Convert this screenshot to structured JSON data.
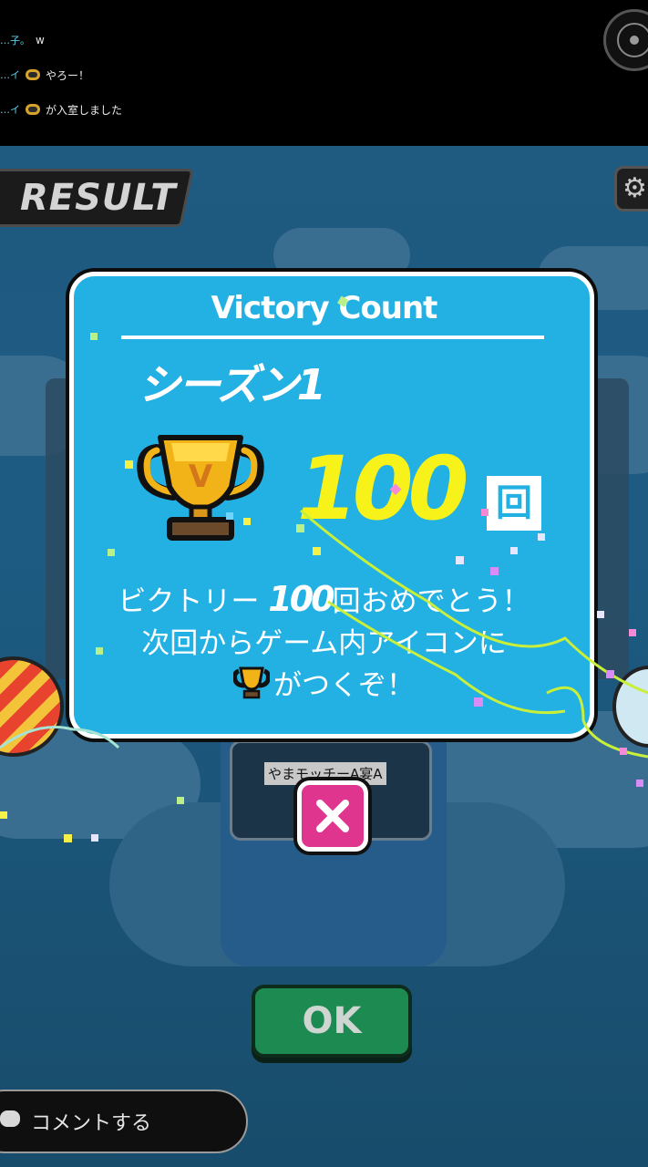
{
  "chat": {
    "messages": [
      {
        "name": "…子。",
        "text": "w"
      },
      {
        "name": "…イ",
        "text": "やろー！"
      },
      {
        "name": "…イ",
        "text": "が入室しました"
      }
    ]
  },
  "header": {
    "title": "RESULT"
  },
  "stage": {
    "player_name": "やまモッチーA宴A",
    "ok_label": "OK"
  },
  "modal": {
    "title": "Victory Count",
    "season": "シーズン1",
    "count": "100",
    "unit": "回",
    "message": {
      "line1_prefix": "ビクトリー ",
      "line1_count": "100",
      "line1_suffix": "回おめでとう！",
      "line2": "次回からゲーム内アイコンに",
      "line3": "がつくぞ！"
    },
    "trophy_letter": "V",
    "accent_color": "#23b0e3",
    "count_color": "#f7f21a",
    "close_color": "#e0358e"
  },
  "footer": {
    "comment_label": "コメントする"
  },
  "icons": {
    "settings": "gear-icon",
    "close": "close-icon",
    "comment": "speech-bubble-icon",
    "trophy": "trophy-icon",
    "dpad": "dpad-icon"
  }
}
